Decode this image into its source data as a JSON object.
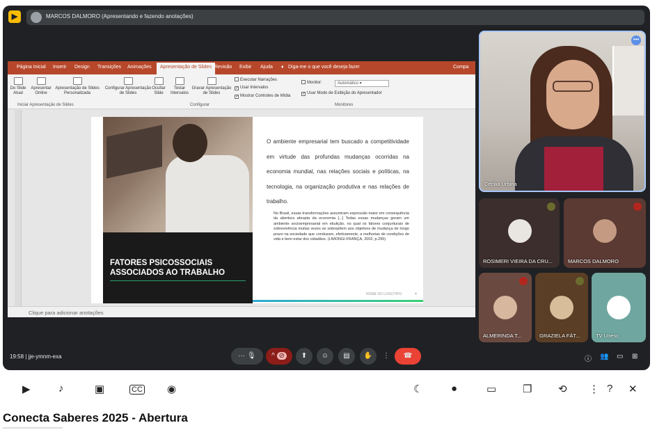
{
  "meet": {
    "presenting_banner": "MARCOS DALMORO (Apresentando e fazendo anotações)",
    "clock": "19:58",
    "meeting_code": "jje-ymnm-exa"
  },
  "ppt": {
    "tabs": [
      "Página Inicial",
      "Inserir",
      "Design",
      "Transições",
      "Animações",
      "Apresentação de Slides",
      "Revisão",
      "Exibir",
      "Ajuda"
    ],
    "active_tab": "Apresentação de Slides",
    "tell_me": "Diga-me o que você deseja fazer",
    "share": "Compa",
    "ribbon": {
      "from_current": "Do Slide Atual",
      "present_online": "Apresentar Online",
      "custom_show": "Apresentação de Slides Personalizada",
      "group_start": "Iniciar Apresentação de Slides",
      "setup_show": "Configurar Apresentação de Slides",
      "hide_slide": "Ocultar Slide",
      "rehearse": "Testar Intervalos",
      "record": "Gravar Apresentação de Slides",
      "group_setup": "Configurar",
      "play_narrations": "Executar Narrações",
      "use_timings": "Usar Intervalos",
      "show_media": "Mostrar Controles de Mídia",
      "monitor": "Monitor:",
      "monitor_value": "Automático",
      "presenter_view": "Usar Modo de Exibição do Apresentador",
      "group_monitors": "Monitores"
    },
    "notes_placeholder": "Clique para adicionar anotações"
  },
  "slide": {
    "title_line1": "FATORES PSICOSSOCIAIS",
    "title_line2": "ASSOCIADOS AO TRABALHO",
    "body": "O ambiente empresarial tem buscado a competitividade em virtude das profundas mudanças ocorridas na economia mundial, nas relações sociais e políticas, na tecnologia, na organização produtiva e nas relações de trabalho.",
    "quote": "No Brasil, essas transformações assumiram expressão maior em consequência da abertura abrupta da economia [...] Todas essas mudanças geram um ambiente socioempresarial em ebulição, no qual os fatores conjunturais de sobrevivência muitas vezes se sobrepõem aos objetivos de mudança de longo prazo na sociedade que conduzam, efetivamente, a melhorias de condições de vida e bem estar dos cidadãos. (LIMONGI-FRANÇA, 2002, p.295)",
    "footer": "NOME DO LOGOTIPO",
    "page": "4"
  },
  "participants": {
    "speaker": "Cecilia Urbina",
    "tiles": [
      "ROSIMERI VIEIRA DA CRU...",
      "MARCOS DALMORO",
      "ALMERINDA T...",
      "GRAZIELA FÁT...",
      "TV Unesc"
    ]
  },
  "video": {
    "title": "Conecta Saberes 2025 - Abertura"
  },
  "colors": {
    "ppt_accent": "#b7472a",
    "hangup": "#ea4335",
    "meet_bg": "#202124"
  }
}
